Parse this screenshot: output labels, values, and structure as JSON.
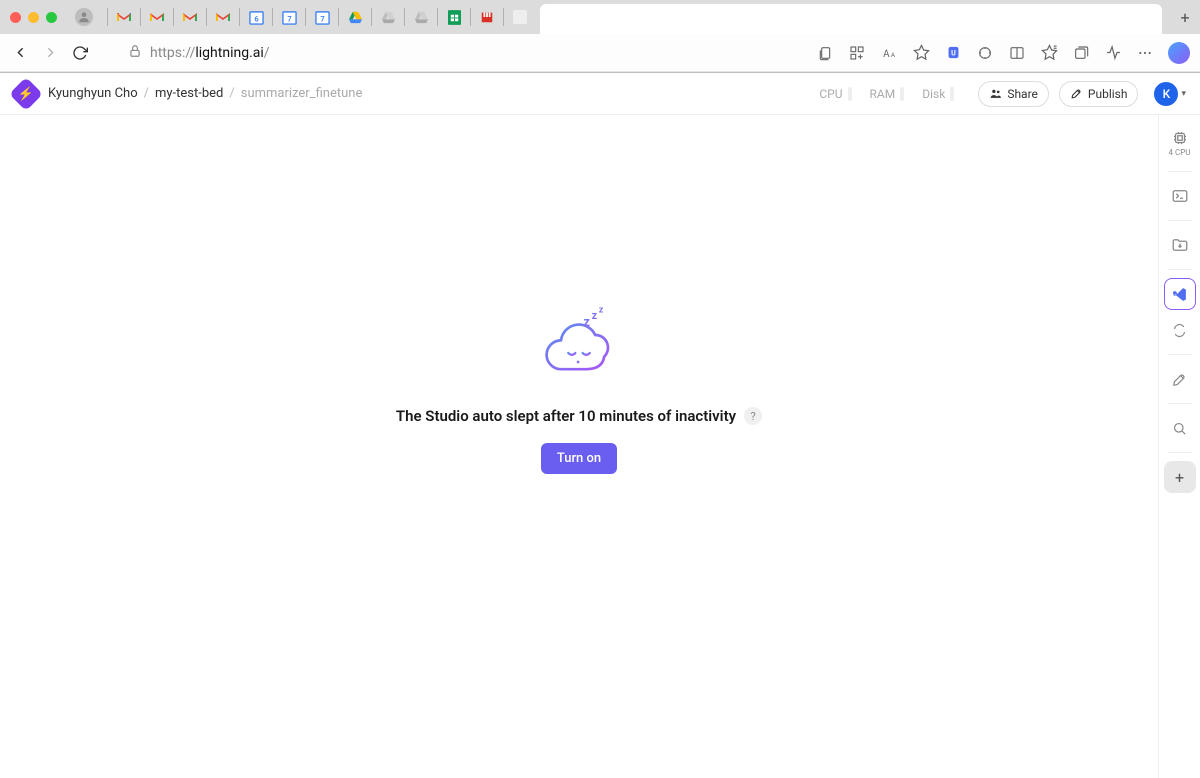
{
  "browser": {
    "url_prefix": "https://",
    "url_host": "lightning.ai",
    "url_path": "/"
  },
  "header": {
    "breadcrumbs": [
      {
        "label": "Kyunghyun Cho",
        "dim": false
      },
      {
        "label": "my-test-bed",
        "dim": false
      },
      {
        "label": "summarizer_finetune",
        "dim": true
      }
    ],
    "stats": {
      "cpu_label": "CPU",
      "ram_label": "RAM",
      "disk_label": "Disk"
    },
    "share_label": "Share",
    "publish_label": "Publish",
    "avatar_initial": "K"
  },
  "main": {
    "sleep_message": "The Studio auto slept after 10 minutes of inactivity",
    "help": "?",
    "turn_on_label": "Turn on"
  },
  "rail": {
    "cpu_label": "4 CPU"
  }
}
